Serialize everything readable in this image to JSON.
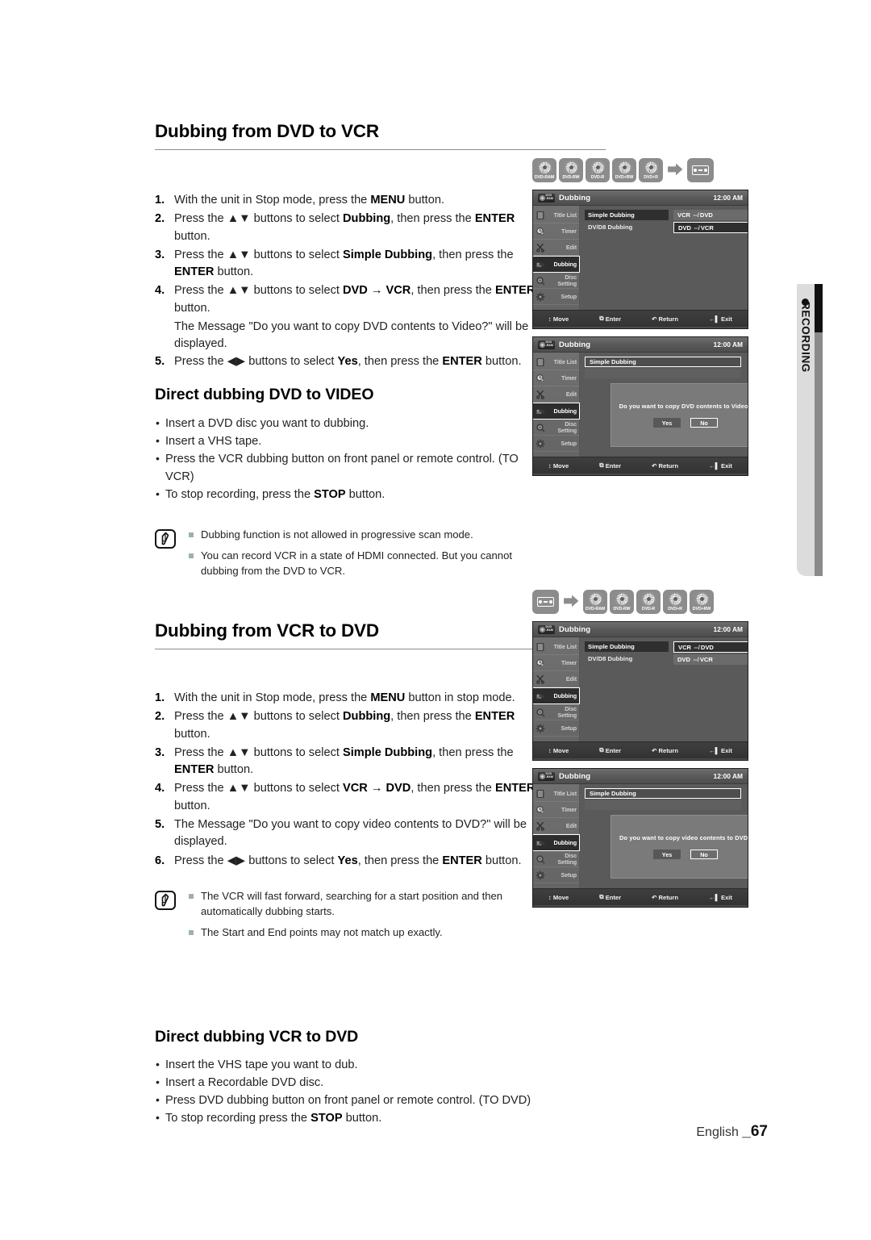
{
  "page": {
    "footer_language": "English ",
    "footer_number": "_67",
    "side_tab_label": "RECORDING"
  },
  "section1": {
    "heading": "Dubbing from DVD to VCR",
    "disc_row": [
      {
        "type": "disc",
        "label": "DVD-RAM"
      },
      {
        "type": "disc",
        "label": "DVD-RW"
      },
      {
        "type": "disc",
        "label": "DVD-R"
      },
      {
        "type": "disc",
        "label": "DVD+RW"
      },
      {
        "type": "disc",
        "label": "DVD+R"
      },
      {
        "type": "arrow",
        "label": "arrow-right-icon"
      },
      {
        "type": "tape",
        "label": "vhs-tape-icon"
      }
    ],
    "steps": [
      {
        "num": "1.",
        "html": "With the unit in Stop mode, press the <b>MENU</b> button."
      },
      {
        "num": "2.",
        "html": "Press the ▲▼ buttons to select <b>Dubbing</b>, then press the <b>ENTER</b> button."
      },
      {
        "num": "3.",
        "html": "Press the ▲▼ buttons to select <b>Simple Dubbing</b>, then press the <b>ENTER</b> button."
      },
      {
        "num": "4.",
        "html": "Press the ▲▼ buttons to select <b>DVD → VCR</b>, then press the <b>ENTER</b> button."
      },
      {
        "num": "",
        "html": "The Message \"Do you want to copy DVD contents to Video?\" will be displayed."
      },
      {
        "num": "5.",
        "html": "Press the ◀▶ buttons to select <b>Yes</b>, then press the <b>ENTER</b> button."
      }
    ],
    "sub_heading": "Direct dubbing DVD to VIDEO",
    "bullets": [
      "Insert a DVD disc you want to dubbing.",
      "Insert a VHS tape.",
      "Press the VCR dubbing button on front panel or remote control. (TO VCR)",
      "To stop recording, press the <b>STOP</b> button."
    ],
    "notes": [
      "Dubbing function is not allowed in progressive scan mode.",
      "You can record VCR in a state of HDMI connected. But you cannot dubbing from the DVD to VCR."
    ]
  },
  "section2": {
    "heading": "Dubbing from VCR to DVD",
    "disc_row": [
      {
        "type": "tape",
        "label": "vhs-tape-icon"
      },
      {
        "type": "arrow",
        "label": "arrow-right-icon"
      },
      {
        "type": "disc",
        "label": "DVD-RAM"
      },
      {
        "type": "disc",
        "label": "DVD-RW"
      },
      {
        "type": "disc",
        "label": "DVD-R"
      },
      {
        "type": "disc",
        "label": "DVD+R"
      },
      {
        "type": "disc",
        "label": "DVD+RW"
      }
    ],
    "steps": [
      {
        "num": "1.",
        "html": "With the unit in Stop mode, press the <b>MENU</b> button in stop mode."
      },
      {
        "num": "2.",
        "html": "Press the ▲▼ buttons to select <b>Dubbing</b>, then press the <b>ENTER</b> button."
      },
      {
        "num": "3.",
        "html": "Press the ▲▼ buttons to select <b>Simple Dubbing</b>, then press the <b>ENTER</b> button."
      },
      {
        "num": "4.",
        "html": "Press the ▲▼ buttons to select <b>VCR → DVD</b>, then press the <b>ENTER</b> button."
      },
      {
        "num": "5.",
        "html": "The Message \"Do you want to copy video contents to DVD?\" will be displayed."
      },
      {
        "num": "6.",
        "html": "Press the ◀▶ buttons to select <b>Yes</b>, then press the <b>ENTER</b> button."
      }
    ],
    "notes": [
      "The VCR will fast forward, searching for a start position and then automatically dubbing starts.",
      "The Start and End points may not match up exactly."
    ],
    "sub_heading": "Direct dubbing VCR to DVD",
    "bullets": [
      "Insert the VHS tape you want to dub.",
      "Insert a Recordable DVD disc.",
      "Press DVD dubbing button on front panel or remote control. (TO DVD)",
      "To stop recording press the <b>STOP</b> button."
    ]
  },
  "osd": {
    "title": "Dubbing",
    "badge_line1": "DVD",
    "badge_line2": "-RAM",
    "clock": "12:00 AM",
    "sidebar": [
      {
        "label": "Title List",
        "icon": "film-strip-icon"
      },
      {
        "label": "Timer",
        "icon": "clock-icon"
      },
      {
        "label": "Edit",
        "icon": "scissors-icon"
      },
      {
        "label": "Dubbing",
        "icon": "camcorder-icon"
      },
      {
        "label": "Disc Setting",
        "icon": "disc-icon"
      },
      {
        "label": "Setup",
        "icon": "gear-icon"
      }
    ],
    "menu_items": [
      "Simple Dubbing",
      "DV/D8 Dubbing"
    ],
    "sub_items": [
      "VCR ⇎ DVD",
      "DVD ⇎ VCR"
    ],
    "footbar": [
      {
        "glyph": "↕",
        "label": "Move"
      },
      {
        "glyph": "⧉",
        "label": "Enter"
      },
      {
        "glyph": "↶",
        "label": "Return"
      },
      {
        "glyph": "←▌",
        "label": "Exit"
      }
    ],
    "dialog_dvd_to_video": {
      "question": "Do you want to copy DVD contents to Video?",
      "yes": "Yes",
      "no": "No"
    },
    "dialog_video_to_dvd": {
      "question": "Do you want to copy video contents to DVD?",
      "yes": "Yes",
      "no": "No"
    }
  }
}
